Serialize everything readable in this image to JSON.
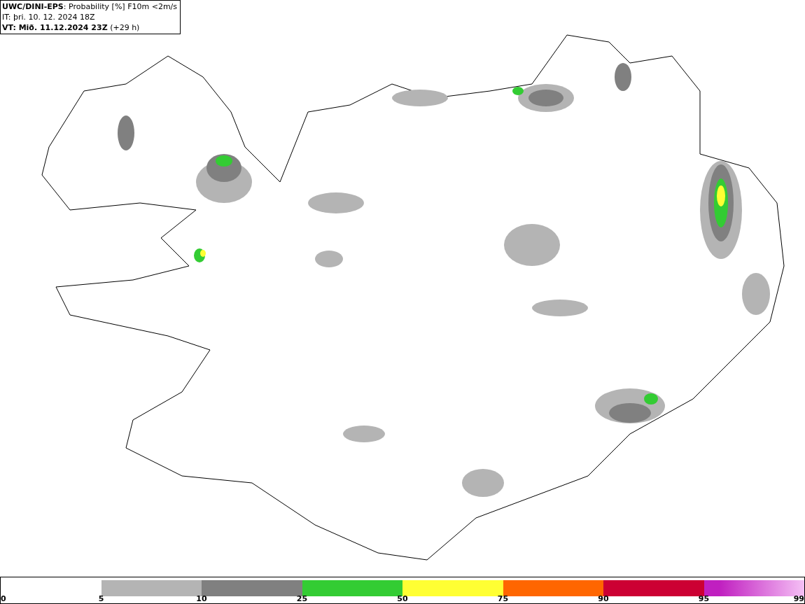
{
  "header": {
    "lines": [
      "**UWC/DINI-EPS**: Probability [%] F10m <2m/s",
      "IT: þri. 10. 12. 2024 18Z",
      "**VT: Mið. 11.12.2024 23Z** (+29 h)"
    ]
  },
  "legend": {
    "segments": [
      {
        "color": "#b4b4b4"
      },
      {
        "color": "#808080"
      },
      {
        "color": "#33cc33"
      },
      {
        "color": "#ffff33"
      },
      {
        "color": "#ff6600"
      },
      {
        "color": "#cc0033"
      },
      {
        "color": "#c01fc0"
      }
    ],
    "ticks": [
      "0",
      "5",
      "10",
      "25",
      "50",
      "75",
      "90",
      "95",
      "99"
    ]
  }
}
